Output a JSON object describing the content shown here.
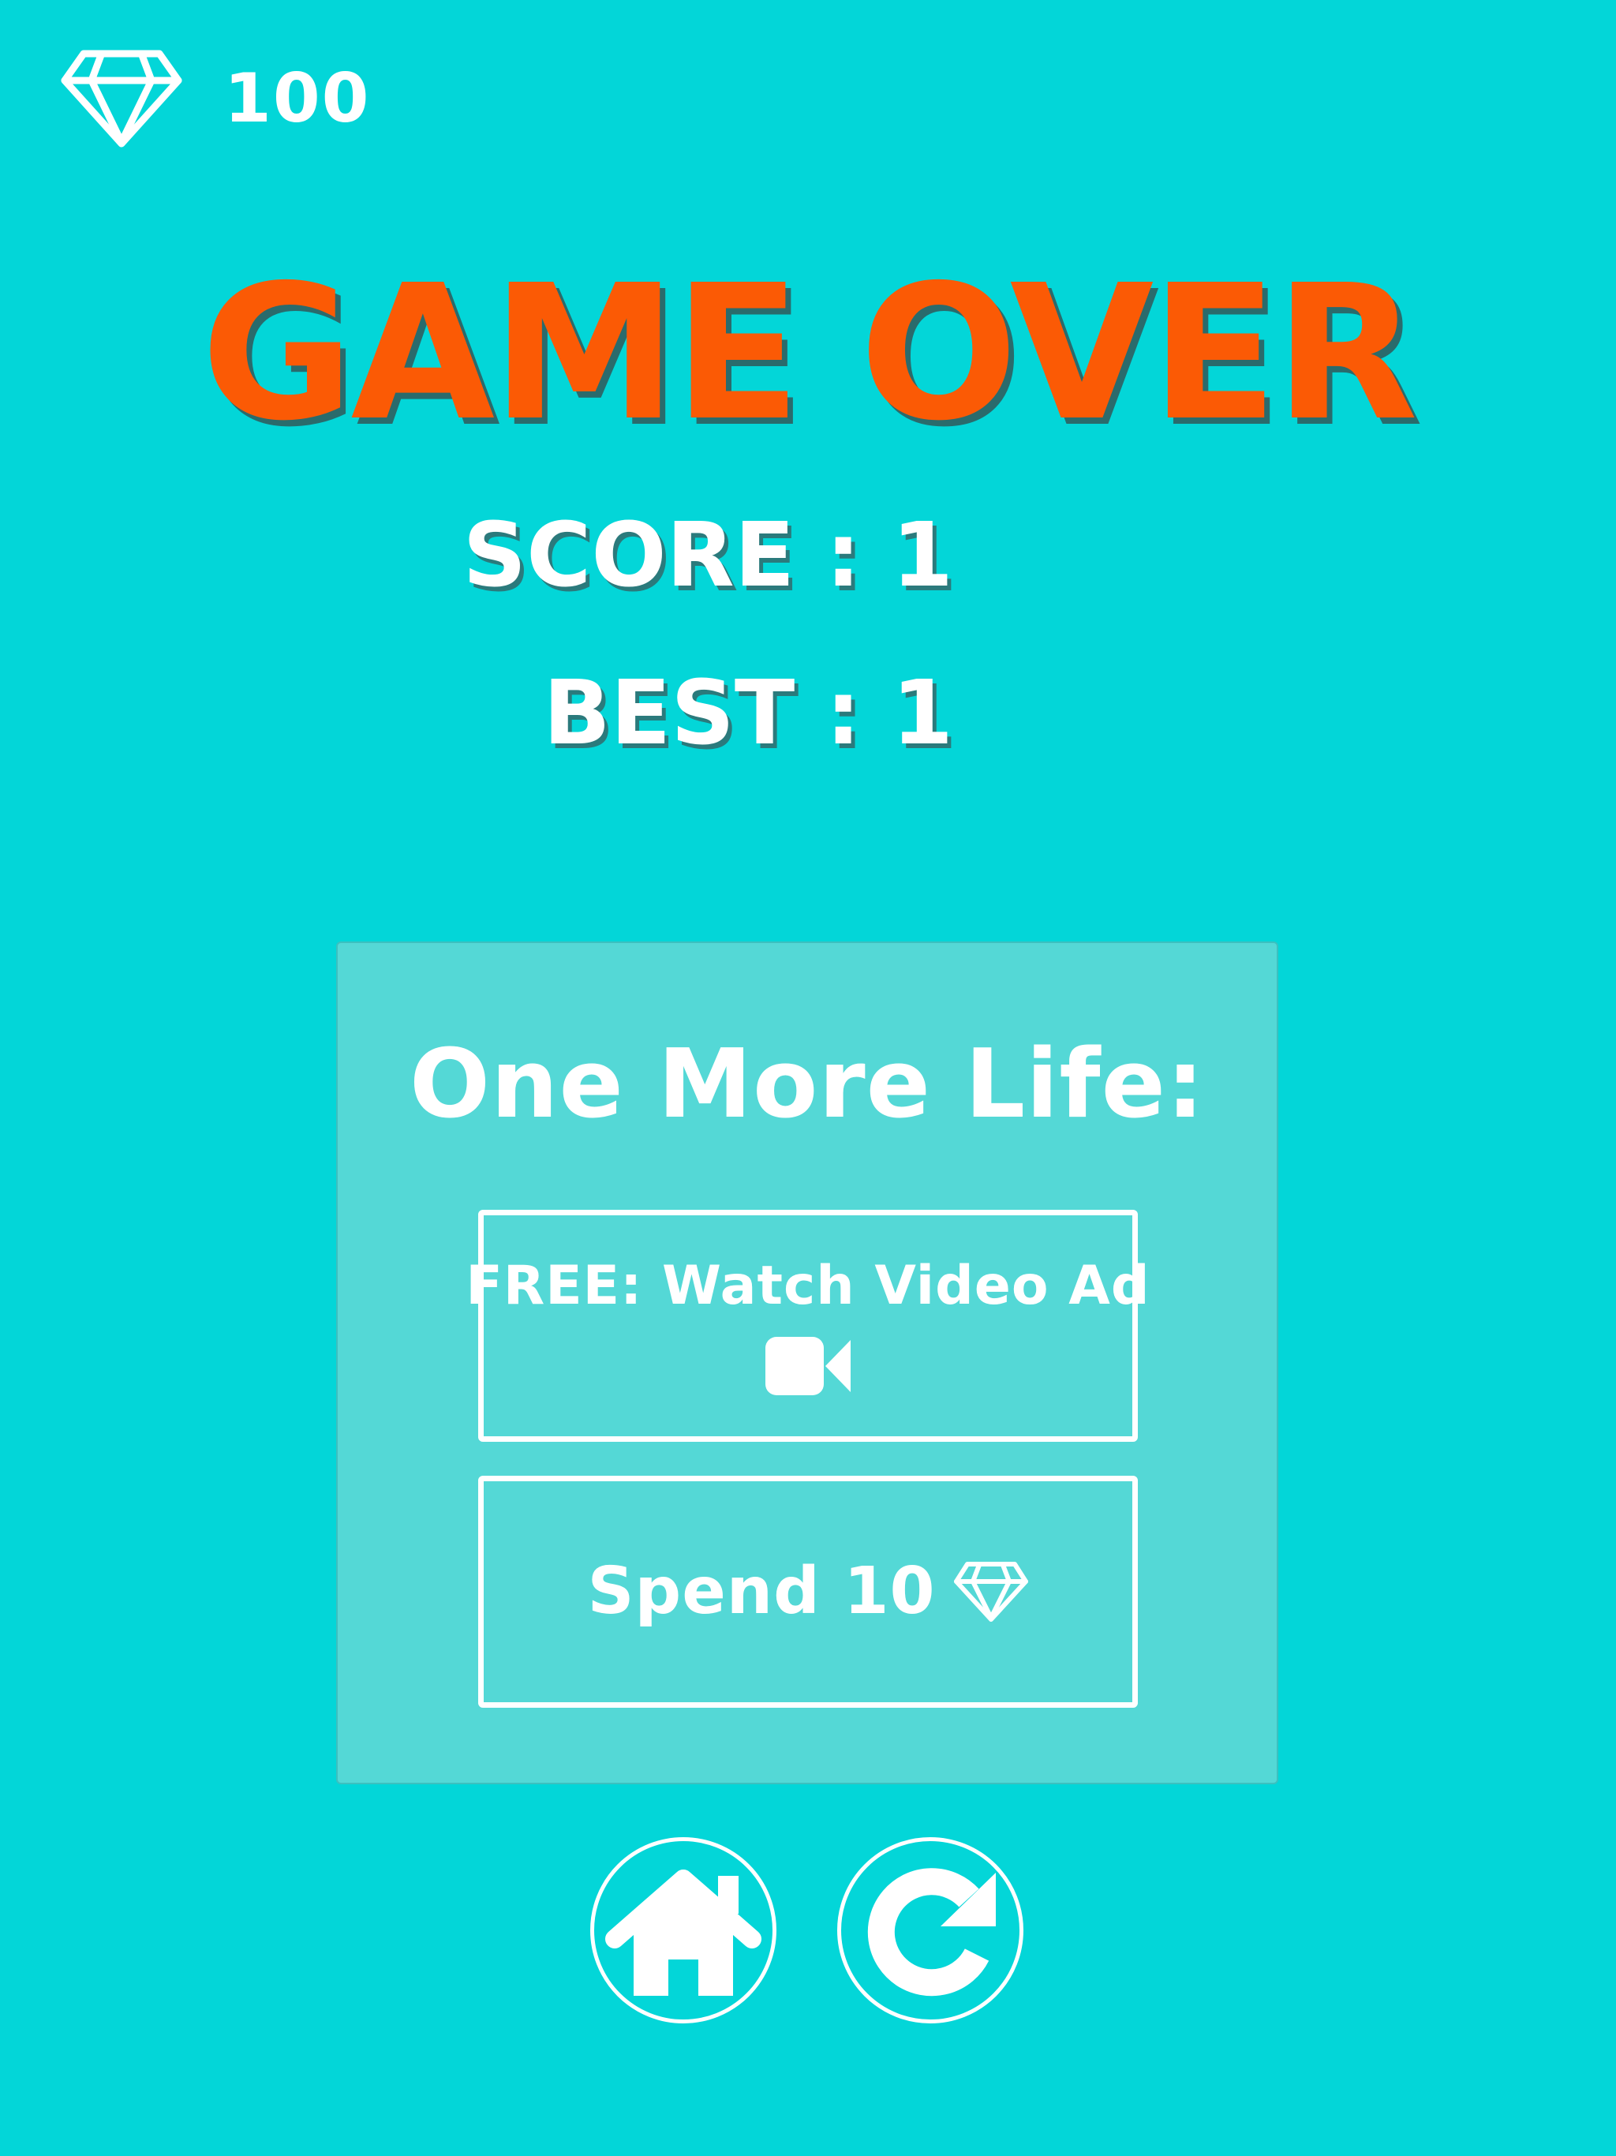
{
  "hud": {
    "gem_icon": "diamond-icon",
    "gem_count": "100"
  },
  "title": "GAME OVER",
  "stats": {
    "score": "SCORE : 1",
    "best": "BEST : 1"
  },
  "continue_panel": {
    "title": "One More Life:",
    "watch_ad": {
      "label": "FREE: Watch Video Ad",
      "icon": "video-camera-icon"
    },
    "spend": {
      "label": "Spend 10",
      "icon": "diamond-icon"
    }
  },
  "buttons": {
    "home_icon": "home-icon",
    "restart_icon": "restart-icon"
  },
  "colors": {
    "background": "#03d6d8",
    "panel": "#54d8d6",
    "title": "#fb5a05",
    "text": "#ffffff"
  }
}
